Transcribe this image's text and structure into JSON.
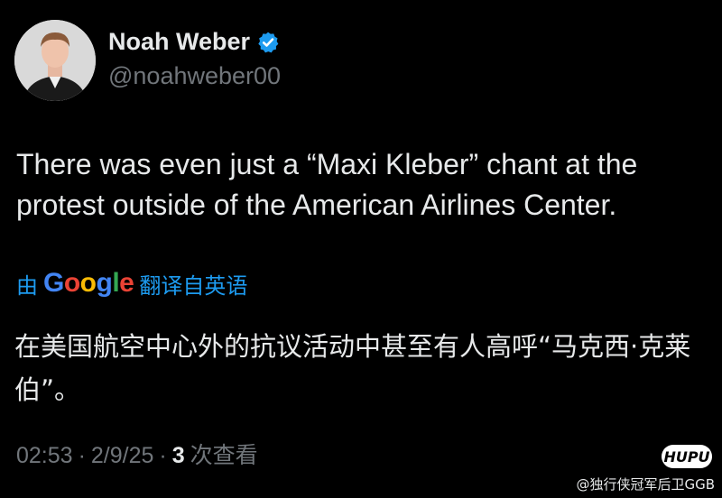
{
  "author": {
    "name": "Noah Weber",
    "handle": "@noahweber00",
    "verified_color": "#1d9bf0"
  },
  "tweet": {
    "text": "There was even just a “Maxi Kleber” chant at the protest outside of the American Airlines Center."
  },
  "translation": {
    "prefix": "由",
    "provider": "Google",
    "suffix": "翻译自英语",
    "text": "在美国航空中心外的抗议活动中甚至有人高呼“马克西·克莱伯”。"
  },
  "meta": {
    "time": "02:53",
    "date": "2/9/25",
    "views_count": "3",
    "views_label": "次查看",
    "separator": "·"
  },
  "watermark": {
    "logo": "HUPU",
    "text": "@独行侠冠军后卫GGB"
  },
  "colors": {
    "background": "#000000",
    "text_primary": "#e7e9ea",
    "text_secondary": "#71767b",
    "link": "#1d9bf0"
  }
}
